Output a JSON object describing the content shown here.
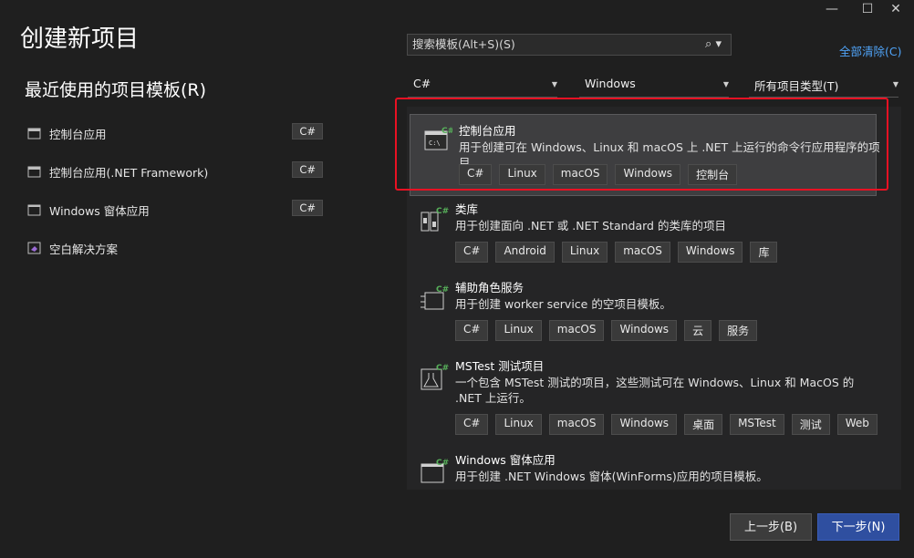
{
  "window": {
    "minimize": "—",
    "maximize": "☐",
    "close": "✕"
  },
  "title": "创建新项目",
  "recent": {
    "heading": "最近使用的项目模板(R)",
    "items": [
      {
        "label": "控制台应用",
        "lang": "C#"
      },
      {
        "label": "控制台应用(.NET Framework)",
        "lang": "C#"
      },
      {
        "label": "Windows 窗体应用",
        "lang": "C#"
      },
      {
        "label": "空白解决方案",
        "lang": ""
      }
    ]
  },
  "search": {
    "placeholder": "搜索模板(Alt+S)(S)"
  },
  "clear_all": "全部清除(C)",
  "filters": {
    "language": "C#",
    "platform": "Windows",
    "project_type": "所有项目类型(T)"
  },
  "templates": [
    {
      "name": "控制台应用",
      "desc": "用于创建可在 Windows、Linux 和 macOS 上 .NET 上运行的命令行应用程序的项目",
      "tags": [
        "C#",
        "Linux",
        "macOS",
        "Windows",
        "控制台"
      ]
    },
    {
      "name": "类库",
      "desc": "用于创建面向 .NET 或 .NET Standard 的类库的项目",
      "tags": [
        "C#",
        "Android",
        "Linux",
        "macOS",
        "Windows",
        "库"
      ]
    },
    {
      "name": "辅助角色服务",
      "desc": "用于创建 worker service 的空项目模板。",
      "tags": [
        "C#",
        "Linux",
        "macOS",
        "Windows",
        "云",
        "服务"
      ]
    },
    {
      "name": "MSTest 测试项目",
      "desc": "一个包含 MSTest 测试的项目，这些测试可在 Windows、Linux 和 MacOS 的 .NET 上运行。",
      "tags": [
        "C#",
        "Linux",
        "macOS",
        "Windows",
        "桌面",
        "MSTest",
        "测试",
        "Web"
      ]
    },
    {
      "name": "Windows 窗体应用",
      "desc": "用于创建 .NET Windows 窗体(WinForms)应用的项目模板。",
      "tags": []
    }
  ],
  "buttons": {
    "back": "上一步(B)",
    "next": "下一步(N)"
  },
  "colors": {
    "accent": "#2f4fa0",
    "highlight": "#e81123",
    "link": "#4fa3f7"
  }
}
